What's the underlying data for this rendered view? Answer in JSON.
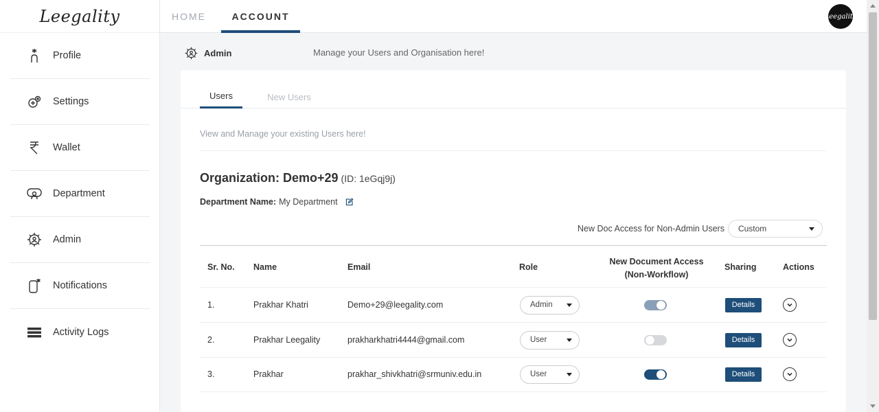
{
  "brand": {
    "logo_text": "Leegality",
    "avatar_text": "Leegality"
  },
  "topnav": {
    "tabs": [
      {
        "label": "HOME"
      },
      {
        "label": "ACCOUNT"
      }
    ],
    "active": "ACCOUNT"
  },
  "sidebar": {
    "items": [
      {
        "label": "Profile",
        "icon": "profile-icon"
      },
      {
        "label": "Settings",
        "icon": "settings-icon"
      },
      {
        "label": "Wallet",
        "icon": "wallet-icon"
      },
      {
        "label": "Department",
        "icon": "department-icon"
      },
      {
        "label": "Admin",
        "icon": "admin-icon"
      },
      {
        "label": "Notifications",
        "icon": "notifications-icon"
      },
      {
        "label": "Activity Logs",
        "icon": "activity-logs-icon"
      }
    ]
  },
  "admin": {
    "title": "Admin",
    "description": "Manage your Users and Organisation here!"
  },
  "tabs": [
    {
      "label": "Users"
    },
    {
      "label": "New Users"
    }
  ],
  "users_panel": {
    "description": "View and Manage your existing Users here!",
    "org_label": "Organization: Demo+29",
    "org_id": "(ID: 1eGqj9j)",
    "dept_label": "Department Name:",
    "dept_value": "My Department",
    "access_label": "New Doc Access for Non-Admin Users",
    "access_value": "Custom"
  },
  "table": {
    "headers": {
      "srno": "Sr. No.",
      "name": "Name",
      "email": "Email",
      "role": "Role",
      "access_line1": "New Document Access",
      "access_line2": "(Non-Workflow)",
      "sharing": "Sharing",
      "actions": "Actions"
    },
    "rows": [
      {
        "sr": "1.",
        "name": "Prakhar Khatri",
        "email": "Demo+29@leegality.com",
        "role": "Admin",
        "access_on": true,
        "access_disabled": true,
        "details": "Details"
      },
      {
        "sr": "2.",
        "name": "Prakhar Leegality",
        "email": "prakharkhatri4444@gmail.com",
        "role": "User",
        "access_on": false,
        "access_disabled": false,
        "details": "Details"
      },
      {
        "sr": "3.",
        "name": "Prakhar",
        "email": "prakhar_shivkhatri@srmuniv.edu.in",
        "role": "User",
        "access_on": true,
        "access_disabled": false,
        "details": "Details"
      }
    ]
  },
  "colors": {
    "primary": "#1e4e79",
    "toggle_disabled": "#8a9fb8",
    "toggle_off": "#d6d8db"
  }
}
